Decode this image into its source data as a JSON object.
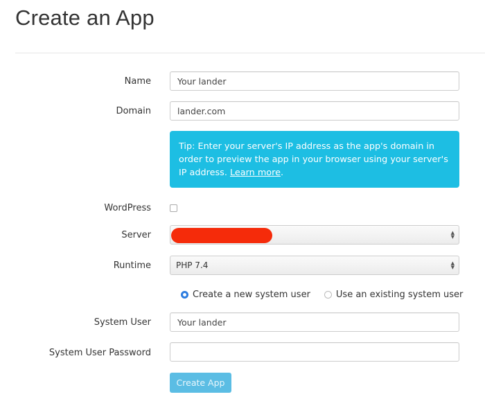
{
  "page": {
    "title": "Create an App"
  },
  "form": {
    "name": {
      "label": "Name",
      "value": "Your lander"
    },
    "domain": {
      "label": "Domain",
      "value": "lander.com"
    },
    "tip": {
      "text": "Tip: Enter your server's IP address as the app's domain in order to preview the app in your browser using your server's IP address. ",
      "link": "Learn more",
      "suffix": "."
    },
    "wordpress": {
      "label": "WordPress",
      "checked": false
    },
    "server": {
      "label": "Server",
      "value": ""
    },
    "runtime": {
      "label": "Runtime",
      "value": "PHP 7.4"
    },
    "system_user_mode": {
      "options": [
        {
          "label": "Create a new system user",
          "selected": true
        },
        {
          "label": "Use an existing system user",
          "selected": false
        }
      ]
    },
    "system_user": {
      "label": "System User",
      "value": "Your lander"
    },
    "system_user_password": {
      "label": "System User Password",
      "value": ""
    },
    "submit_label": "Create App"
  },
  "colors": {
    "tip_bg": "#1dbee3",
    "button_bg": "#5bbde4",
    "radio_accent": "#2d7de0",
    "redaction": "#f52b0a"
  }
}
